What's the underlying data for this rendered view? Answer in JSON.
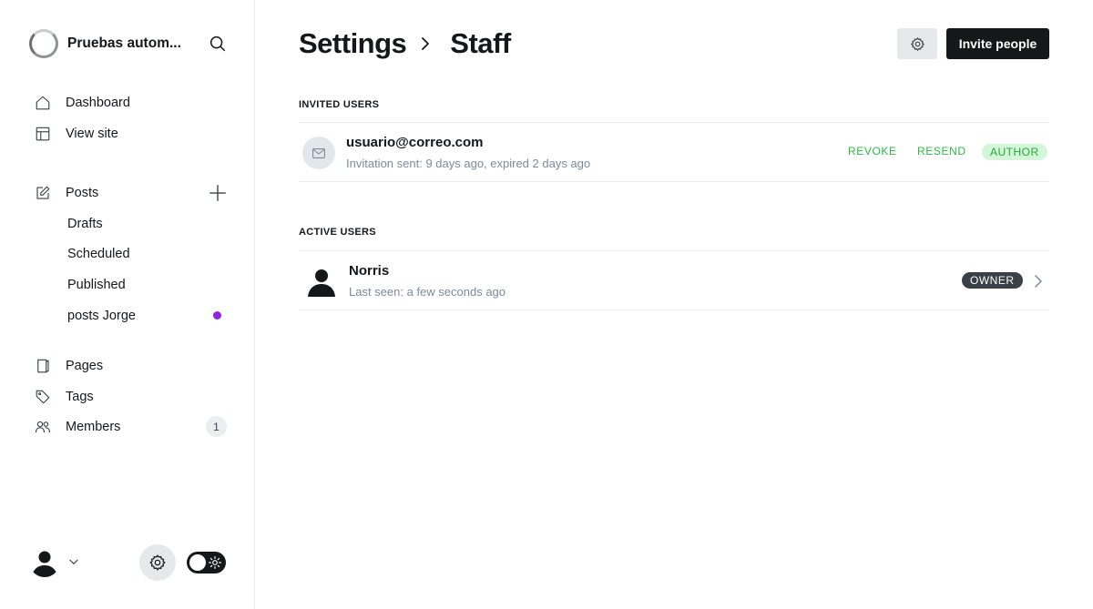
{
  "site": {
    "title": "Pruebas autom..."
  },
  "sidebar": {
    "items": [
      {
        "label": "Dashboard",
        "icon": "home-icon"
      },
      {
        "label": "View site",
        "icon": "layout-icon"
      },
      {
        "label": "Posts",
        "icon": "edit-icon"
      },
      {
        "label": "Pages",
        "icon": "page-icon"
      },
      {
        "label": "Tags",
        "icon": "tag-icon"
      },
      {
        "label": "Members",
        "icon": "members-icon",
        "count": "1"
      }
    ],
    "posts_sub": [
      {
        "label": "Drafts"
      },
      {
        "label": "Scheduled"
      },
      {
        "label": "Published"
      },
      {
        "label": "posts Jorge"
      }
    ],
    "accent_dot_color": "#8e24e8"
  },
  "header": {
    "breadcrumb_parent": "Settings",
    "breadcrumb_current": "Staff",
    "invite_label": "Invite people"
  },
  "invited": {
    "section_title": "INVITED USERS",
    "users": [
      {
        "email": "usuario@correo.com",
        "status": "Invitation sent: 9 days ago, expired 2 days ago",
        "revoke_label": "REVOKE",
        "resend_label": "RESEND",
        "role": "AUTHOR"
      }
    ]
  },
  "active": {
    "section_title": "ACTIVE USERS",
    "users": [
      {
        "name": "Norris",
        "last_seen": "Last seen: a few seconds ago",
        "role": "OWNER"
      }
    ]
  },
  "colors": {
    "action_green": "#2fb844",
    "author_badge_bg": "#d3f6d9",
    "owner_badge_bg": "#394047",
    "primary_button": "#15171a"
  }
}
